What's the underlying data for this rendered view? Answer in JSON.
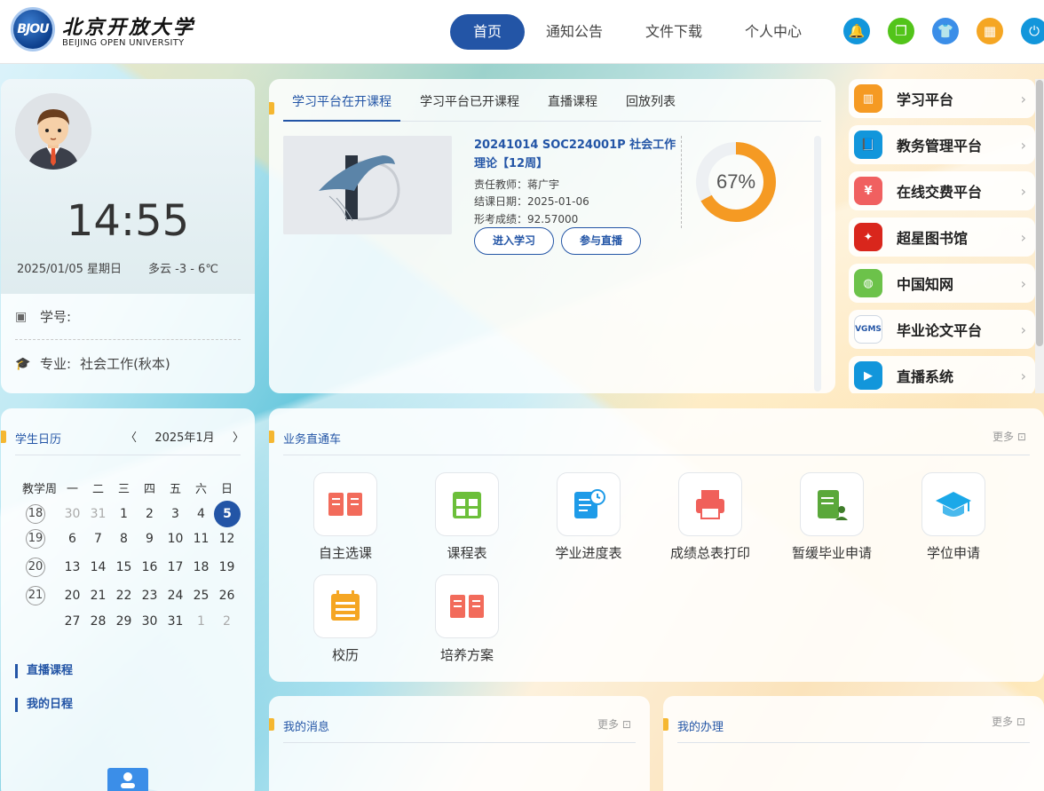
{
  "header": {
    "logo_badge": "BJOU",
    "logo_cn": "北京开放大学",
    "logo_en": "BEIJING OPEN UNIVERSITY",
    "nav": [
      "首页",
      "通知公告",
      "文件下载",
      "个人中心"
    ],
    "icons": [
      {
        "name": "bell-icon",
        "color": "#1296db",
        "glyph": "🔔"
      },
      {
        "name": "copy-icon",
        "color": "#52c41a",
        "glyph": "❐"
      },
      {
        "name": "shirt-icon",
        "color": "#3b8ee8",
        "glyph": "👕"
      },
      {
        "name": "qrcode-icon",
        "color": "#f5a623",
        "glyph": "▦"
      },
      {
        "name": "power-icon",
        "color": "#1296db",
        "glyph": "⏻"
      }
    ]
  },
  "profile": {
    "time": "14:55",
    "date": "2025/01/05 星期日",
    "weather": "多云 -3 - 6℃",
    "student_id_label": "学号:",
    "major_label": "专业:",
    "major_value": "社会工作(秋本)"
  },
  "courses": {
    "tabs": [
      "学习平台在开课程",
      "学习平台已开课程",
      "直播课程",
      "回放列表"
    ],
    "course": {
      "title": "20241014 SOC224001P 社会工作理论【12周】",
      "teacher": "责任教师：蒋广宇",
      "end_date": "结课日期：2025-01-06",
      "score": "形考成绩：92.57000",
      "progress_pct": 67,
      "progress_text": "67%",
      "btn_study": "进入学习",
      "btn_live": "参与直播"
    }
  },
  "platforms": [
    {
      "label": "学习平台",
      "color": "#f59a23",
      "glyph": "▥",
      "icon": "bar-chart-icon"
    },
    {
      "label": "教务管理平台",
      "color": "#1296db",
      "glyph": "📘",
      "icon": "book-icon"
    },
    {
      "label": "在线交费平台",
      "color": "#f06060",
      "glyph": "¥",
      "icon": "payment-icon"
    },
    {
      "label": "超星图书馆",
      "color": "#d9261c",
      "glyph": "✦",
      "icon": "chaoxing-icon"
    },
    {
      "label": "中国知网",
      "color": "#6cc24a",
      "glyph": "◍",
      "icon": "globe-icon"
    },
    {
      "label": "毕业论文平台",
      "color": "#ffffff",
      "glyph": "VGMS",
      "icon": "vgms-icon"
    },
    {
      "label": "直播系统",
      "color": "#1296db",
      "glyph": "▶",
      "icon": "tv-icon"
    }
  ],
  "calendar": {
    "title": "学生日历",
    "month": "2025年1月",
    "headers": [
      "教学周",
      "一",
      "二",
      "三",
      "四",
      "五",
      "六",
      "日"
    ],
    "rows": [
      {
        "week": "18",
        "days": [
          "30",
          "31",
          "1",
          "2",
          "3",
          "4",
          "5"
        ],
        "dim": [
          0,
          1
        ],
        "today": 6
      },
      {
        "week": "19",
        "days": [
          "6",
          "7",
          "8",
          "9",
          "10",
          "11",
          "12"
        ],
        "dim": [],
        "today": -1
      },
      {
        "week": "20",
        "days": [
          "13",
          "14",
          "15",
          "16",
          "17",
          "18",
          "19"
        ],
        "dim": [],
        "today": -1
      },
      {
        "week": "21",
        "days": [
          "20",
          "21",
          "22",
          "23",
          "24",
          "25",
          "26"
        ],
        "dim": [],
        "today": -1
      },
      {
        "week": "",
        "days": [
          "27",
          "28",
          "29",
          "30",
          "31",
          "1",
          "2"
        ],
        "dim": [
          5,
          6
        ],
        "today": -1
      }
    ],
    "links": [
      "直播课程",
      "我的日程"
    ]
  },
  "business": {
    "title": "业务直通车",
    "more": "更多",
    "services": [
      {
        "label": "自主选课",
        "icon": "course-select-icon",
        "color": "#f26b5b"
      },
      {
        "label": "课程表",
        "icon": "timetable-icon",
        "color": "#6cbf3a"
      },
      {
        "label": "学业进度表",
        "icon": "progress-doc-icon",
        "color": "#1e9be8"
      },
      {
        "label": "成绩总表打印",
        "icon": "printer-icon",
        "color": "#f0605a"
      },
      {
        "label": "暂缓毕业申请",
        "icon": "deferral-doc-icon",
        "color": "#5aa83a"
      },
      {
        "label": "学位申请",
        "icon": "graduation-cap-icon",
        "color": "#1ba8e8"
      },
      {
        "label": "校历",
        "icon": "school-calendar-icon",
        "color": "#f5a623"
      },
      {
        "label": "培养方案",
        "icon": "training-plan-icon",
        "color": "#f26b5b"
      }
    ]
  },
  "messages": {
    "title": "我的消息",
    "more": "更多"
  },
  "todos": {
    "title": "我的办理",
    "more": "更多"
  }
}
